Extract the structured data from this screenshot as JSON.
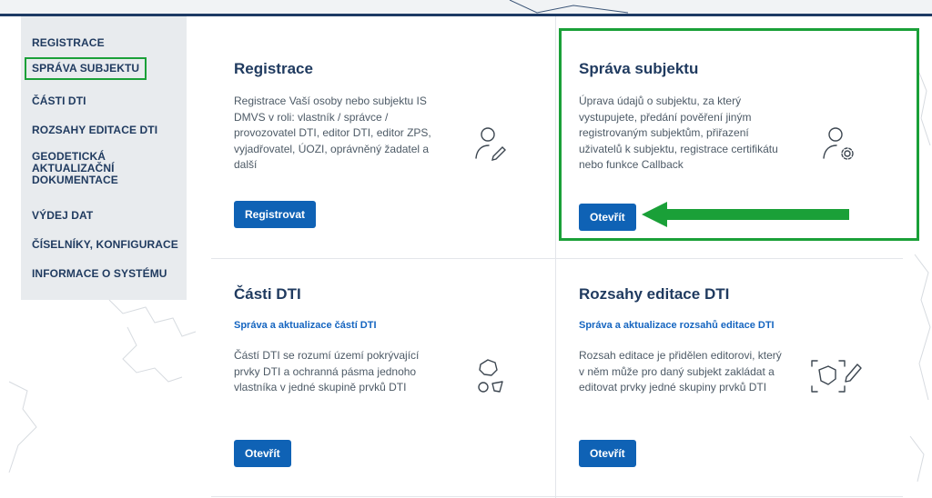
{
  "sidebar": {
    "items": [
      {
        "label": "REGISTRACE"
      },
      {
        "label": "SPRÁVA SUBJEKTU"
      },
      {
        "label": "ČÁSTI DTI"
      },
      {
        "label": "ROZSAHY EDITACE DTI"
      },
      {
        "label": "GEODETICKÁ AKTUALIZAČNÍ DOKUMENTACE"
      },
      {
        "label": "VÝDEJ DAT"
      },
      {
        "label": "ČÍSELNÍKY, KONFIGURACE"
      },
      {
        "label": "INFORMACE O SYSTÉMU"
      }
    ],
    "active_index": 1
  },
  "cards": {
    "registrace": {
      "title": "Registrace",
      "description": "Registrace Vaší osoby nebo subjektu IS DMVS v roli: vlastník / správce / provozovatel DTI, editor DTI, editor ZPS, vyjadřovatel, ÚOZI, oprávněný žadatel a další",
      "button_label": "Registrovat",
      "icon": "user-edit-icon"
    },
    "sprava": {
      "title": "Správa subjektu",
      "description": "Úprava údajů o subjektu, za který vystupujete, předání pověření jiným registrovaným subjektům, přiřazení uživatelů k subjektu, registrace certifikátu nebo funkce Callback",
      "button_label": "Otevřít",
      "icon": "user-settings-icon"
    },
    "casti": {
      "title": "Části DTI",
      "subtitle": "Správa a aktualizace částí DTI",
      "description": "Částí DTI se rozumí území pokrývající prvky DTI a ochranná pásma jednoho vlastníka v jedné skupině prvků DTI",
      "button_label": "Otevřít",
      "icon": "area-shapes-icon"
    },
    "rozsahy": {
      "title": "Rozsahy editace DTI",
      "subtitle": "Správa a aktualizace rozsahů editace DTI",
      "description": "Rozsah editace je přidělen editorovi, který v něm může pro daný subjekt zakládat a editovat prvky jedné skupiny prvků DTI",
      "button_label": "Otevřít",
      "icon": "area-edit-icon"
    }
  },
  "colors": {
    "primary": "#0f62b5",
    "highlight": "#1aa038",
    "title": "#1f3a5f",
    "link": "#1565c0"
  }
}
